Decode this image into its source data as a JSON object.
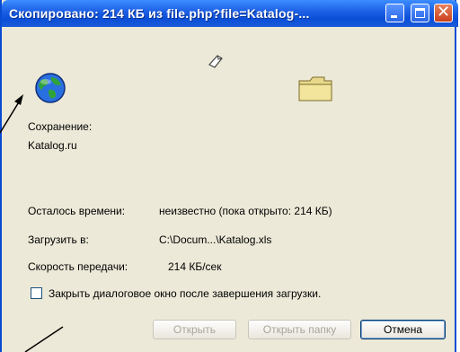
{
  "window": {
    "title": "Скопировано: 214 КБ из file.php?file=Katalog-..."
  },
  "labels": {
    "saving": "Сохранение:",
    "source": "Katalog.ru",
    "time_left_label": "Осталось времени:",
    "time_left_value": "неизвестно (пока открыто: 214 КБ)",
    "download_to_label": "Загрузить в:",
    "download_to_value": "C:\\Docum...\\Katalog.xls",
    "speed_label": "Скорость передачи:",
    "speed_value": "214 КБ/сек"
  },
  "checkbox": {
    "label": "Закрыть диалоговое окно после завершения загрузки.",
    "checked": false
  },
  "buttons": {
    "open": "Открыть",
    "open_folder": "Открыть папку",
    "cancel": "Отмена"
  },
  "colors": {
    "titlebar": "#0b4fd8",
    "dialog_bg": "#ece9d8",
    "close_button": "#c9401b"
  }
}
